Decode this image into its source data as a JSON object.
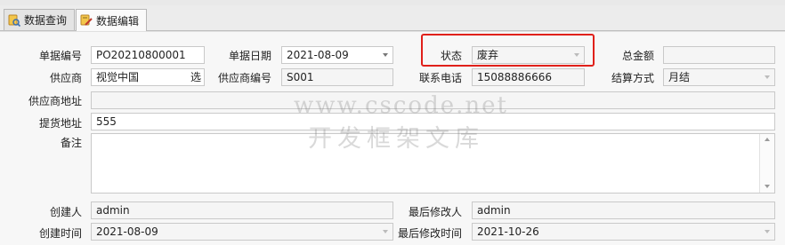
{
  "tabs": [
    {
      "label": "数据查询",
      "icon": "data-query-icon",
      "active": false
    },
    {
      "label": "数据编辑",
      "icon": "data-edit-icon",
      "active": true
    }
  ],
  "form": {
    "doc_no": {
      "label": "单据编号",
      "value": "PO20210800001"
    },
    "doc_date": {
      "label": "单据日期",
      "value": "2021-08-09"
    },
    "status": {
      "label": "状态",
      "value": "废弃"
    },
    "total_amount": {
      "label": "总金额",
      "value": ""
    },
    "supplier": {
      "label": "供应商",
      "value": "视觉中国",
      "pick": "选"
    },
    "supplier_code": {
      "label": "供应商编号",
      "value": "S001"
    },
    "phone": {
      "label": "联系电话",
      "value": "15088886666"
    },
    "settlement": {
      "label": "结算方式",
      "value": "月结"
    },
    "supplier_address": {
      "label": "供应商地址",
      "value": ""
    },
    "pickup_address": {
      "label": "提货地址",
      "value": "555"
    },
    "remark": {
      "label": "备注",
      "value": ""
    },
    "creator": {
      "label": "创建人",
      "value": "admin"
    },
    "last_modifier": {
      "label": "最后修改人",
      "value": "admin"
    },
    "created_at": {
      "label": "创建时间",
      "value": "2021-08-09"
    },
    "modified_at": {
      "label": "最后修改时间",
      "value": "2021-10-26"
    }
  },
  "watermark": {
    "line1": "www.cscode.net",
    "line2": "开发框架文库"
  },
  "colors": {
    "highlight": "#e0201a",
    "panel": "#f7f7f7",
    "field_border": "#c9c9c9"
  }
}
